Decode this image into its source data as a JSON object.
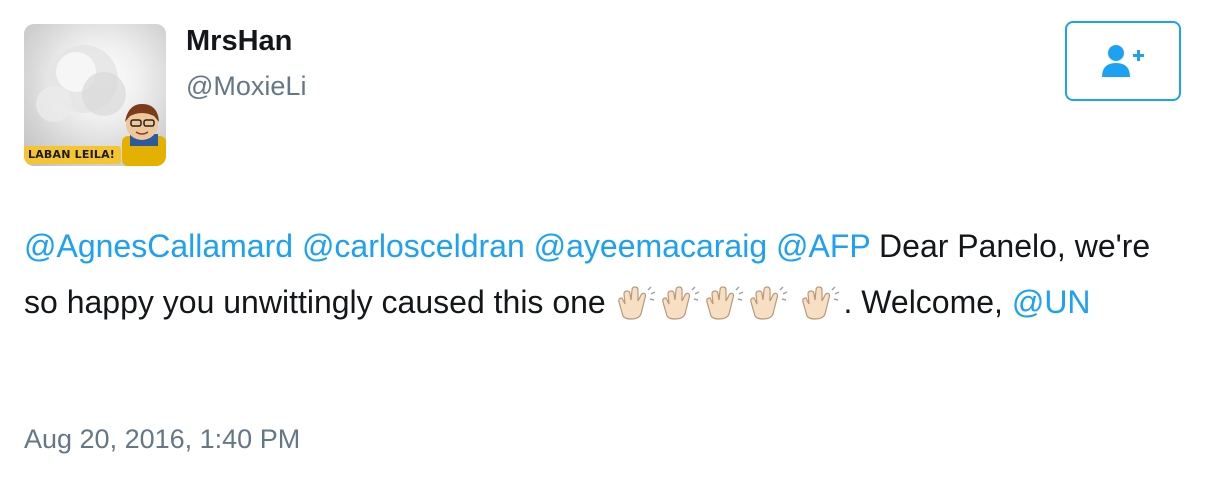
{
  "user": {
    "display_name": "MrsHan",
    "handle": "@MoxieLi",
    "avatar_banner": "LABAN LEILA!"
  },
  "follow_button": {
    "icon": "add-user-icon"
  },
  "tweet": {
    "mentions": [
      "@AgnesCallamard",
      "@carlosceldran",
      "@ayeemacaraig",
      "@AFP"
    ],
    "text_part1": "Dear Panelo, we're so happy you unwittingly caused this one",
    "emoji": "clapping-hands-emoji",
    "text_part2": ". Welcome,",
    "mention_un": "@UN"
  },
  "timestamp": "Aug 20, 2016, 1:40 PM",
  "colors": {
    "accent": "#1da1f2",
    "text": "#14171a",
    "muted": "#657786"
  }
}
